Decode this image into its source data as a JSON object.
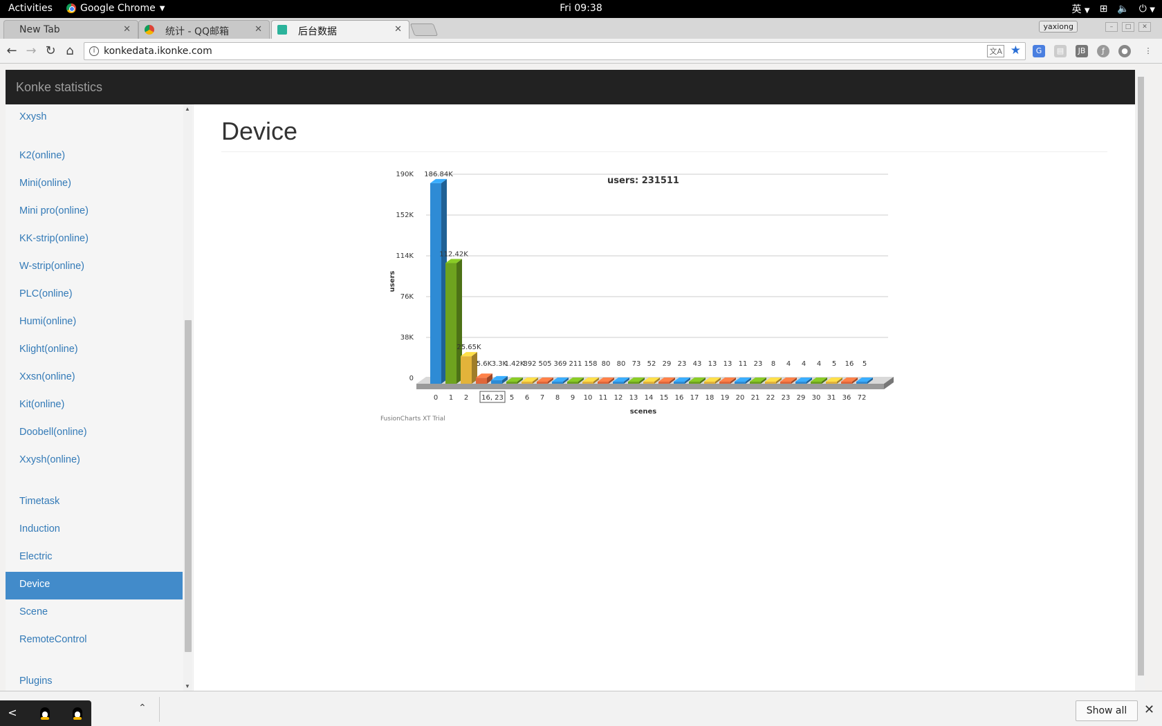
{
  "system": {
    "activities": "Activities",
    "app_name": "Google Chrome",
    "clock": "Fri 09:38",
    "input_method": "英"
  },
  "browser": {
    "tabs": [
      {
        "label": "New Tab",
        "active": false
      },
      {
        "label": "统计 - QQ邮箱",
        "active": false
      },
      {
        "label": "后台数据",
        "active": true
      }
    ],
    "profile": "yaxiong",
    "url": "konkedata.ikonke.com"
  },
  "app": {
    "brand": "Konke statistics",
    "sidebar": {
      "items": [
        {
          "label": "Xxysh"
        },
        {
          "label": "K2(online)"
        },
        {
          "label": "Mini(online)"
        },
        {
          "label": "Mini pro(online)"
        },
        {
          "label": "KK-strip(online)"
        },
        {
          "label": "W-strip(online)"
        },
        {
          "label": "PLC(online)"
        },
        {
          "label": "Humi(online)"
        },
        {
          "label": "Klight(online)"
        },
        {
          "label": "Xxsn(online)"
        },
        {
          "label": "Kit(online)"
        },
        {
          "label": "Doobell(online)"
        },
        {
          "label": "Xxysh(online)"
        },
        {
          "label": "Timetask"
        },
        {
          "label": "Induction"
        },
        {
          "label": "Electric"
        },
        {
          "label": "Device",
          "active": true
        },
        {
          "label": "Scene"
        },
        {
          "label": "RemoteControl"
        },
        {
          "label": "Plugins"
        }
      ]
    },
    "page_title": "Device"
  },
  "chart_data": {
    "type": "bar",
    "title": "users: 231511",
    "xlabel": "scenes",
    "ylabel": "users",
    "ylim": [
      0,
      190000
    ],
    "yticks": [
      "0",
      "38K",
      "76K",
      "114K",
      "152K",
      "190K"
    ],
    "categories": [
      "0",
      "1",
      "2",
      "16, 23",
      "5",
      "6",
      "7",
      "8",
      "9",
      "10",
      "11",
      "12",
      "13",
      "14",
      "15",
      "16",
      "17",
      "18",
      "19",
      "20",
      "21",
      "22",
      "23",
      "29",
      "30",
      "31",
      "36",
      "72"
    ],
    "values": [
      186840,
      112420,
      25650,
      5600,
      3300,
      1420,
      892,
      505,
      369,
      211,
      158,
      80,
      80,
      73,
      52,
      29,
      23,
      43,
      13,
      13,
      11,
      23,
      8,
      4,
      4,
      4,
      5,
      16,
      5
    ],
    "value_labels": [
      "186.84K",
      "112.42K",
      "25.65K",
      "5.6K",
      "3.3K",
      "1.42K",
      "892",
      "505",
      "369",
      "211",
      "158",
      "80",
      "80",
      "73",
      "52",
      "29",
      "23",
      "43",
      "13",
      "13",
      "11",
      "23",
      "8",
      "4",
      "4",
      "4",
      "5",
      "16",
      "5"
    ],
    "colors": [
      "#2e8bd5",
      "#6ea31f",
      "#e3b33a",
      "#e0673a"
    ],
    "tooltip": "16, 23",
    "watermark": "FusionCharts XT Trial",
    "grid": true
  },
  "bottom_bar": {
    "show_all": "Show all"
  }
}
